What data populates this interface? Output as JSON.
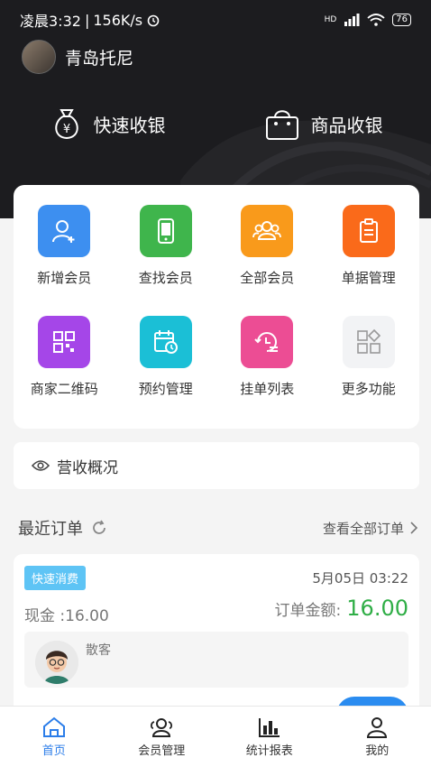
{
  "status_bar": {
    "time": "凌晨3:32",
    "speed": "156K/s",
    "network": "HD",
    "battery": "76"
  },
  "profile": {
    "shop_name": "青岛托尼"
  },
  "quick": [
    {
      "label": "快速收银",
      "icon": "money-bag-icon"
    },
    {
      "label": "商品收银",
      "icon": "shopping-bag-icon"
    }
  ],
  "menu": [
    {
      "label": "新增会员",
      "color": "#3d8ff0",
      "icon": "add-member-icon"
    },
    {
      "label": "查找会员",
      "color": "#3fb54c",
      "icon": "phone-icon"
    },
    {
      "label": "全部会员",
      "color": "#f99a1b",
      "icon": "members-icon"
    },
    {
      "label": "单据管理",
      "color": "#fa6a1a",
      "icon": "clipboard-icon"
    },
    {
      "label": "商家二维码",
      "color": "#a546e8",
      "icon": "qrcode-icon"
    },
    {
      "label": "预约管理",
      "color": "#1bbfd6",
      "icon": "calendar-clock-icon"
    },
    {
      "label": "挂单列表",
      "color": "#ec4d94",
      "icon": "history-list-icon"
    },
    {
      "label": "更多功能",
      "color": "#f2f3f5",
      "icon": "more-apps-icon"
    }
  ],
  "revenue": {
    "label": "营收概况"
  },
  "recent": {
    "title": "最近订单",
    "view_all": "查看全部订单"
  },
  "order": {
    "badge": "快速消费",
    "time": "5月05日 03:22",
    "cash": "现金 :16.00",
    "amount_label": "订单金额:",
    "amount": "16.00",
    "customer": "散客"
  },
  "tabs": [
    {
      "label": "首页",
      "icon": "home-icon",
      "active": true
    },
    {
      "label": "会员管理",
      "icon": "members-icon",
      "active": false
    },
    {
      "label": "统计报表",
      "icon": "bar-chart-icon",
      "active": false
    },
    {
      "label": "我的",
      "icon": "user-icon",
      "active": false
    }
  ]
}
